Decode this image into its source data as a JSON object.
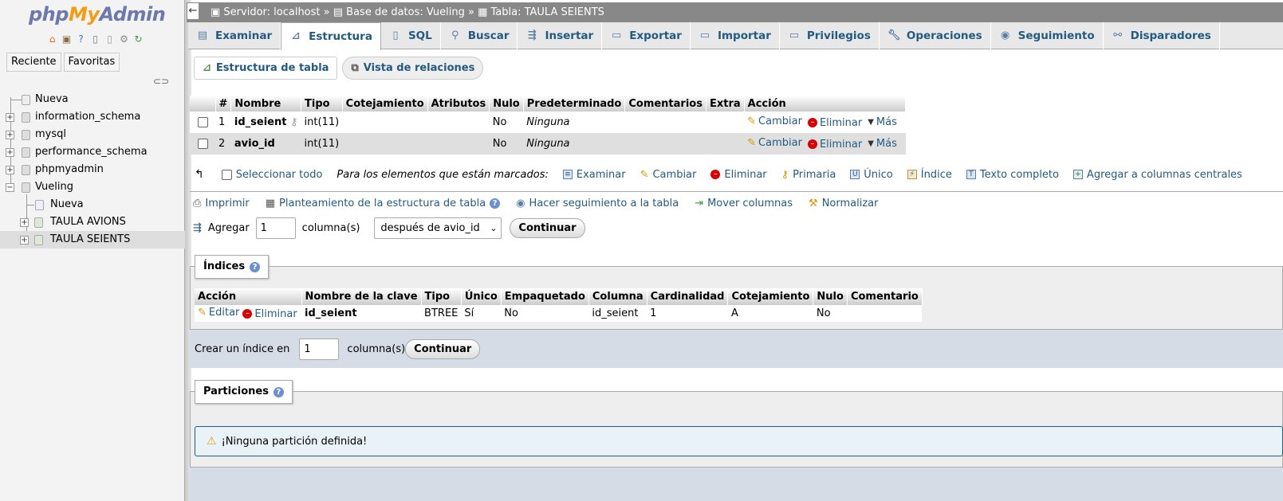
{
  "sidebar": {
    "logo": {
      "php": "php",
      "my": "My",
      "admin": "Admin"
    },
    "nav": {
      "recent": "Reciente",
      "favorites": "Favoritas"
    },
    "tree": [
      {
        "label": "Nueva"
      },
      {
        "label": "information_schema"
      },
      {
        "label": "mysql"
      },
      {
        "label": "performance_schema"
      },
      {
        "label": "phpmyadmin"
      },
      {
        "label": "Vueling"
      },
      {
        "label": "Nueva"
      },
      {
        "label": "TAULA AVIONS"
      },
      {
        "label": "TAULA SEIENTS"
      }
    ]
  },
  "breadcrumb": {
    "server": "Servidor: localhost",
    "sep1": " » ",
    "db": "Base de datos: Vueling",
    "sep2": " » ",
    "table": "Tabla: TAULA SEIENTS"
  },
  "tabs": [
    {
      "label": "Examinar",
      "icon": "browse-icon"
    },
    {
      "label": "Estructura",
      "icon": "structure-icon"
    },
    {
      "label": "SQL",
      "icon": "sql-icon"
    },
    {
      "label": "Buscar",
      "icon": "search-icon"
    },
    {
      "label": "Insertar",
      "icon": "insert-icon"
    },
    {
      "label": "Exportar",
      "icon": "export-icon"
    },
    {
      "label": "Importar",
      "icon": "import-icon"
    },
    {
      "label": "Privilegios",
      "icon": "privileges-icon"
    },
    {
      "label": "Operaciones",
      "icon": "wrench-icon"
    },
    {
      "label": "Seguimiento",
      "icon": "eye-icon"
    },
    {
      "label": "Disparadores",
      "icon": "triggers-icon"
    }
  ],
  "subtabs": {
    "structure": "Estructura de tabla",
    "relations": "Vista de relaciones"
  },
  "structure": {
    "headers": [
      "#",
      "Nombre",
      "Tipo",
      "Cotejamiento",
      "Atributos",
      "Nulo",
      "Predeterminado",
      "Comentarios",
      "Extra",
      "Acción"
    ],
    "rows": [
      {
        "num": "1",
        "name": "id_seient",
        "type": "int(11)",
        "collation": "",
        "attributes": "",
        "null": "No",
        "default": "Ninguna",
        "comments": "",
        "extra": ""
      },
      {
        "num": "2",
        "name": "avio_id",
        "type": "int(11)",
        "collation": "",
        "attributes": "",
        "null": "No",
        "default": "Ninguna",
        "comments": "",
        "extra": ""
      }
    ],
    "actions": {
      "change": "Cambiar",
      "drop": "Eliminar",
      "more": "Más"
    }
  },
  "bulk": {
    "select_all": "Seleccionar todo",
    "with_selected": "Para los elementos que están marcados:",
    "browse": "Examinar",
    "change": "Cambiar",
    "drop": "Eliminar",
    "primary": "Primaria",
    "unique": "Único",
    "index": "Índice",
    "fulltext": "Texto completo",
    "central": "Agregar a columnas centrales"
  },
  "tools": {
    "print": "Imprimir",
    "propose": "Planteamiento de la estructura de tabla",
    "track": "Hacer seguimiento a la tabla",
    "move": "Mover columnas",
    "normalize": "Normalizar"
  },
  "add_columns": {
    "label": "Agregar",
    "count": "1",
    "unit": "columna(s)",
    "position": "después de avio_id",
    "go": "Continuar"
  },
  "indexes": {
    "legend": "Índices",
    "headers": [
      "Acción",
      "Nombre de la clave",
      "Tipo",
      "Único",
      "Empaquetado",
      "Columna",
      "Cardinalidad",
      "Cotejamiento",
      "Nulo",
      "Comentario"
    ],
    "row": {
      "edit": "Editar",
      "drop": "Eliminar",
      "key": "id_seient",
      "type": "BTREE",
      "unique": "Sí",
      "packed": "No",
      "column": "id_seient",
      "cardinality": "1",
      "collation": "A",
      "null": "No",
      "comment": ""
    },
    "create_label": "Crear un índice en",
    "create_count": "1",
    "create_unit": "columna(s)",
    "go": "Continuar"
  },
  "partitions": {
    "legend": "Particiones",
    "message": "¡Ninguna partición definida!"
  }
}
